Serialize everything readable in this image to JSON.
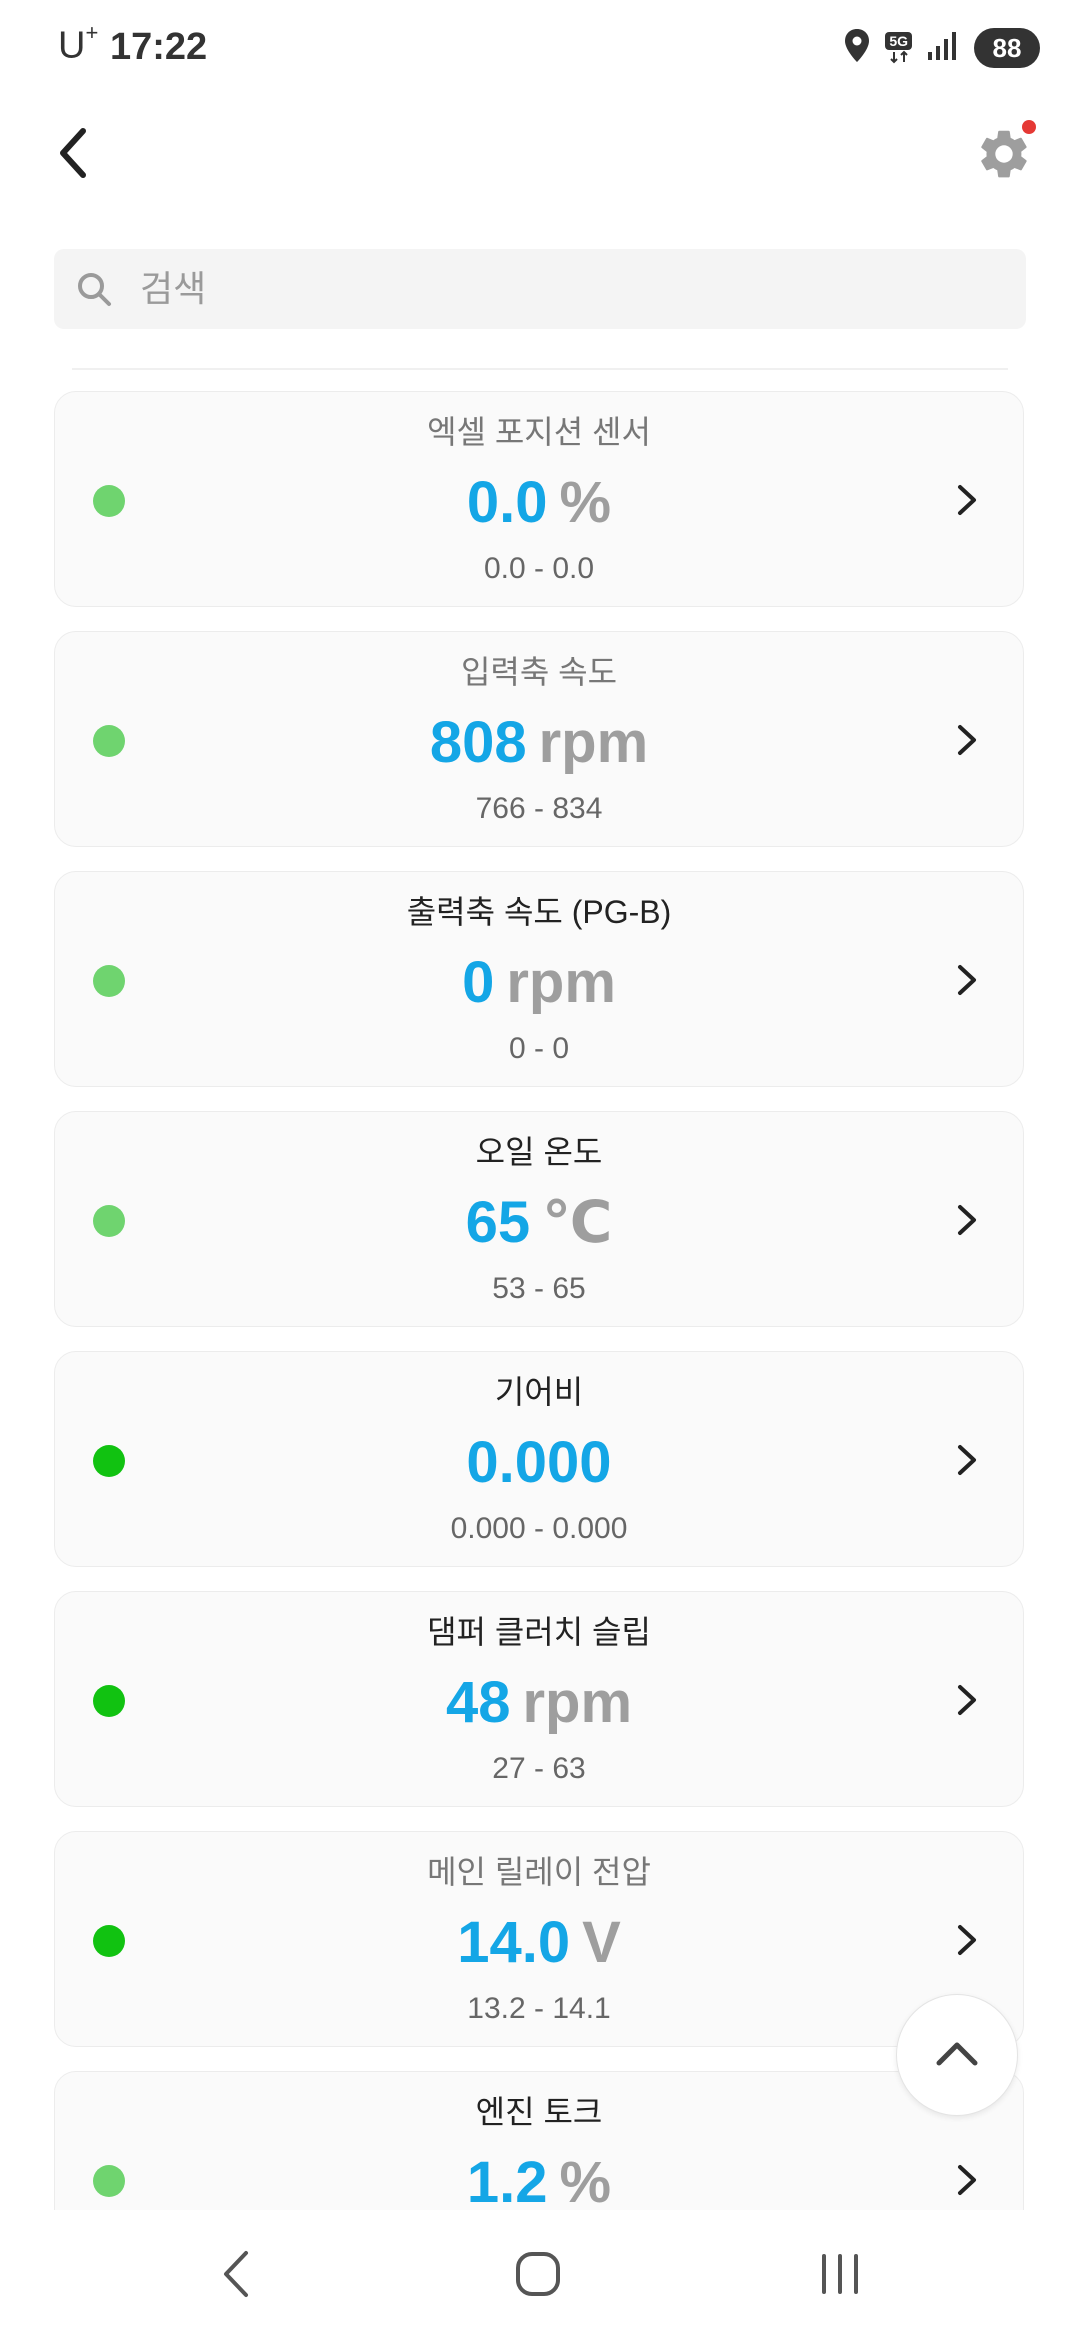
{
  "status_bar": {
    "carrier": "U",
    "carrier_sup": "+",
    "time": "17:22",
    "network": "5G",
    "battery": "88"
  },
  "header": {
    "back_icon": "chevron-left-icon",
    "settings_icon": "gear-icon",
    "has_notification": true
  },
  "search": {
    "placeholder": "검색",
    "value": ""
  },
  "colors": {
    "value": "#14a6e6",
    "unit": "#9e9e9e",
    "status_green_light": "#6fd46f",
    "status_green": "#11c211",
    "notification": "#e53935"
  },
  "items": [
    {
      "title": "엑셀 포지션 센서",
      "value": "0.0",
      "unit": "%",
      "range": "0.0 - 0.0",
      "status_color": "#6fd46f",
      "title_muted": true
    },
    {
      "title": "입력축 속도",
      "value": "808",
      "unit": "rpm",
      "range": "766 - 834",
      "status_color": "#6fd46f",
      "title_muted": true
    },
    {
      "title": "출력축 속도 (PG-B)",
      "value": "0",
      "unit": "rpm",
      "range": "0 - 0",
      "status_color": "#6fd46f",
      "title_muted": false
    },
    {
      "title": "오일 온도",
      "value": "65",
      "unit": "℃",
      "range": "53 - 65",
      "status_color": "#6fd46f",
      "title_muted": false
    },
    {
      "title": "기어비",
      "value": "0.000",
      "unit": "",
      "range": "0.000 - 0.000",
      "status_color": "#11c211",
      "title_muted": false
    },
    {
      "title": "댐퍼 클러치 슬립",
      "value": "48",
      "unit": "rpm",
      "range": "27 - 63",
      "status_color": "#11c211",
      "title_muted": false
    },
    {
      "title": "메인 릴레이 전압",
      "value": "14.0",
      "unit": "V",
      "range": "13.2 - 14.1",
      "status_color": "#11c211",
      "title_muted": true
    },
    {
      "title": "엔진 토크",
      "value": "1.2",
      "unit": "%",
      "range": "",
      "status_color": "#6fd46f",
      "title_muted": false
    }
  ],
  "scroll_top_icon": "chevron-up-icon",
  "nav_bar": {
    "back_icon": "nav-back-icon",
    "home_icon": "nav-home-icon",
    "recents_icon": "nav-recents-icon"
  }
}
